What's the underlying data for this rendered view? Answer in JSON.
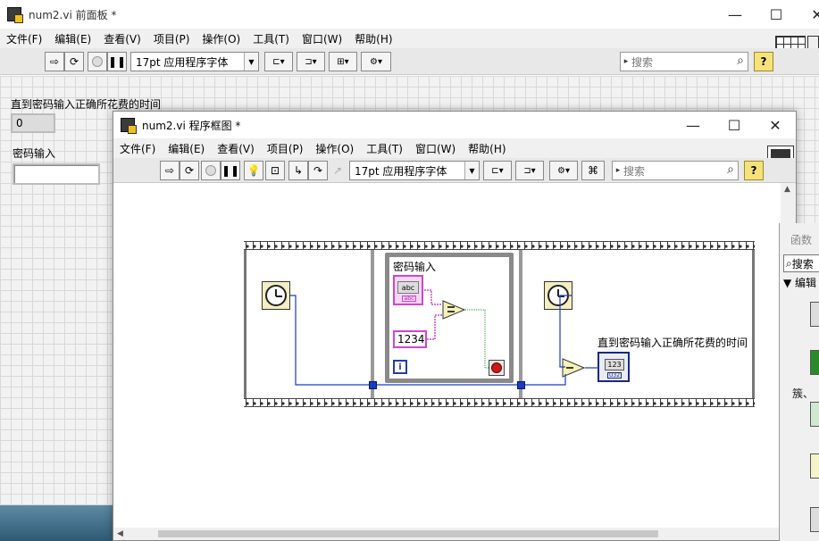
{
  "front_panel": {
    "title": "num2.vi 前面板 *",
    "menu": [
      "文件(F)",
      "编辑(E)",
      "查看(V)",
      "项目(P)",
      "操作(O)",
      "工具(T)",
      "窗口(W)",
      "帮助(H)"
    ],
    "font_combo": "17pt 应用程序字体",
    "search_placeholder": "搜索",
    "help_label": "?",
    "indicator_label": "直到密码输入正确所花费的时间",
    "indicator_value": "0",
    "control_label": "密码输入",
    "control_value": ""
  },
  "block_diagram": {
    "title": "num2.vi 程序框图 *",
    "menu": [
      "文件(F)",
      "编辑(E)",
      "查看(V)",
      "项目(P)",
      "操作(O)",
      "工具(T)",
      "窗口(W)",
      "帮助(H)"
    ],
    "font_combo": "17pt 应用程序字体",
    "search_placeholder": "搜索",
    "help_label": "?",
    "while_loop_label": "密码输入",
    "string_terminal_text": "abc",
    "string_terminal_sub": "abc",
    "string_constant": "1234",
    "iteration_label": "i",
    "indicator_label": "直到密码输入正确所花费的时间",
    "numeric_terminal_text": "123",
    "numeric_terminal_sub": "U32"
  },
  "functions_palette": {
    "title": "函数",
    "search_label": "搜索",
    "edit_label": "编辑",
    "cluster_label": "簇、"
  },
  "window_buttons": {
    "minimize": "—",
    "maximize": "☐",
    "close": "✕"
  }
}
